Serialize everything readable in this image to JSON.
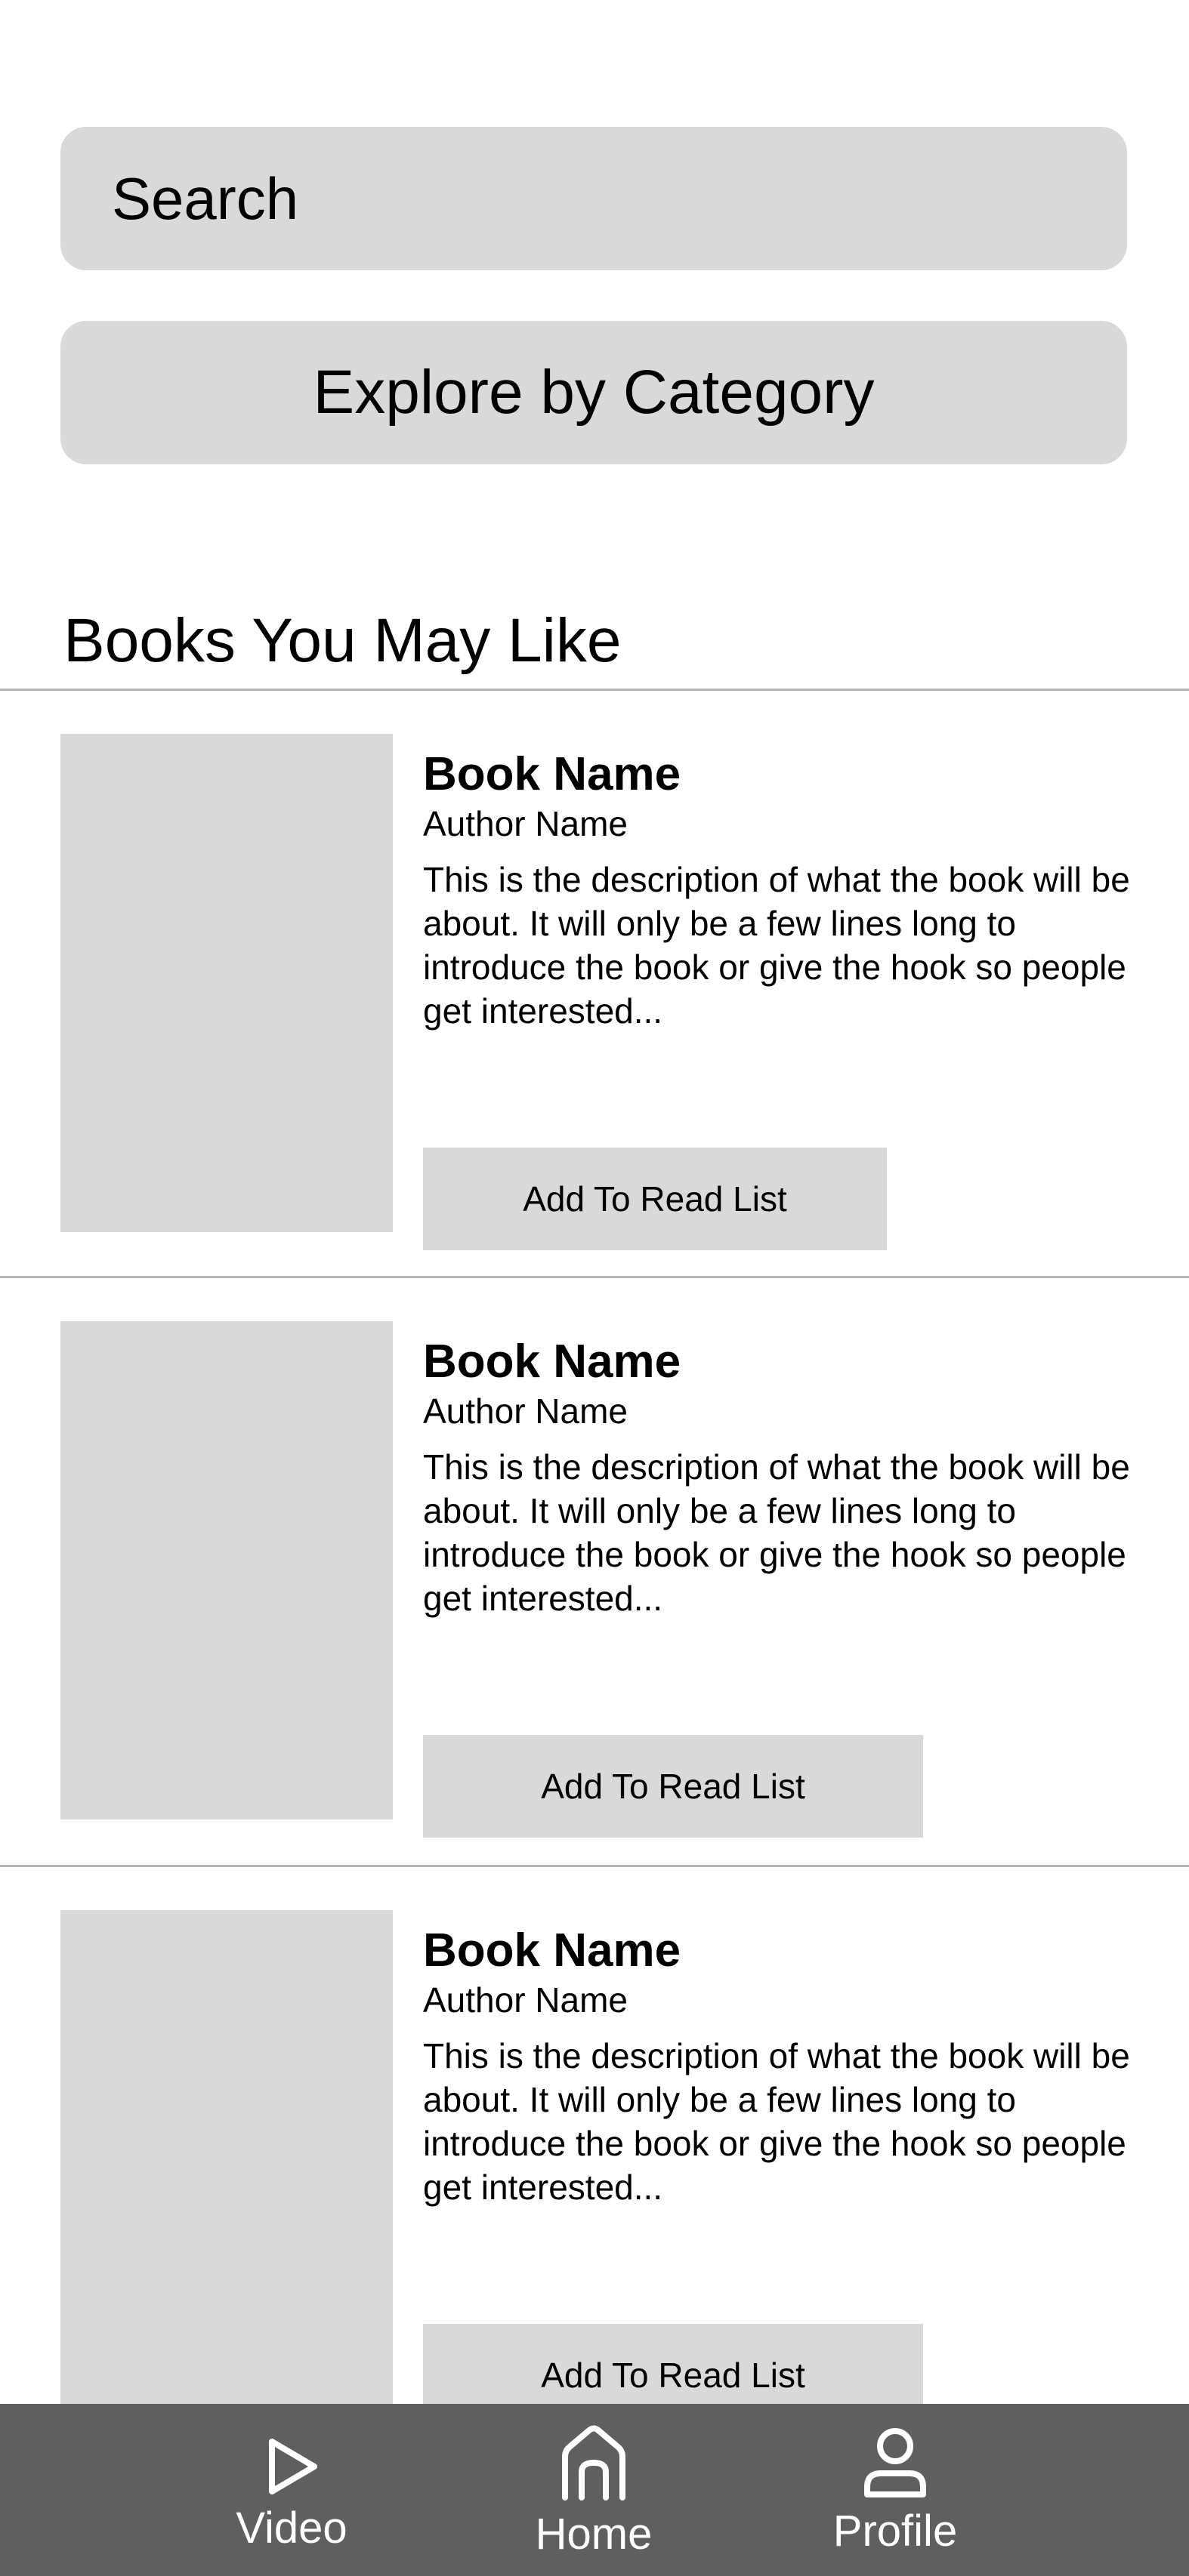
{
  "search": {
    "label": "Search"
  },
  "category": {
    "label": "Explore by Category"
  },
  "section": {
    "title": "Books You May Like"
  },
  "books": [
    {
      "name": "Book Name",
      "author": "Author Name",
      "description": "This is the description of what the book will be about. It will only be a few lines long to introduce the book or give the hook so people get interested...",
      "button_label": "Add To Read List"
    },
    {
      "name": "Book Name",
      "author": "Author Name",
      "description": "This is the description of what the book will be about. It will only be a few lines long to introduce the book or give the hook so people get interested...",
      "button_label": "Add To Read List"
    },
    {
      "name": "Book Name",
      "author": "Author Name",
      "description": "This is the description of what the book will be about. It will only be a few lines long to introduce the book or give the hook so people get interested...",
      "button_label": "Add To Read List"
    }
  ],
  "nav": {
    "items": [
      {
        "label": "Video",
        "icon": "play-icon"
      },
      {
        "label": "Home",
        "icon": "home-icon"
      },
      {
        "label": "Profile",
        "icon": "user-icon"
      }
    ]
  },
  "colors": {
    "placeholder_gray": "#d9d9d9",
    "nav_background": "#5f5f5f",
    "divider": "#b3b3b3"
  }
}
